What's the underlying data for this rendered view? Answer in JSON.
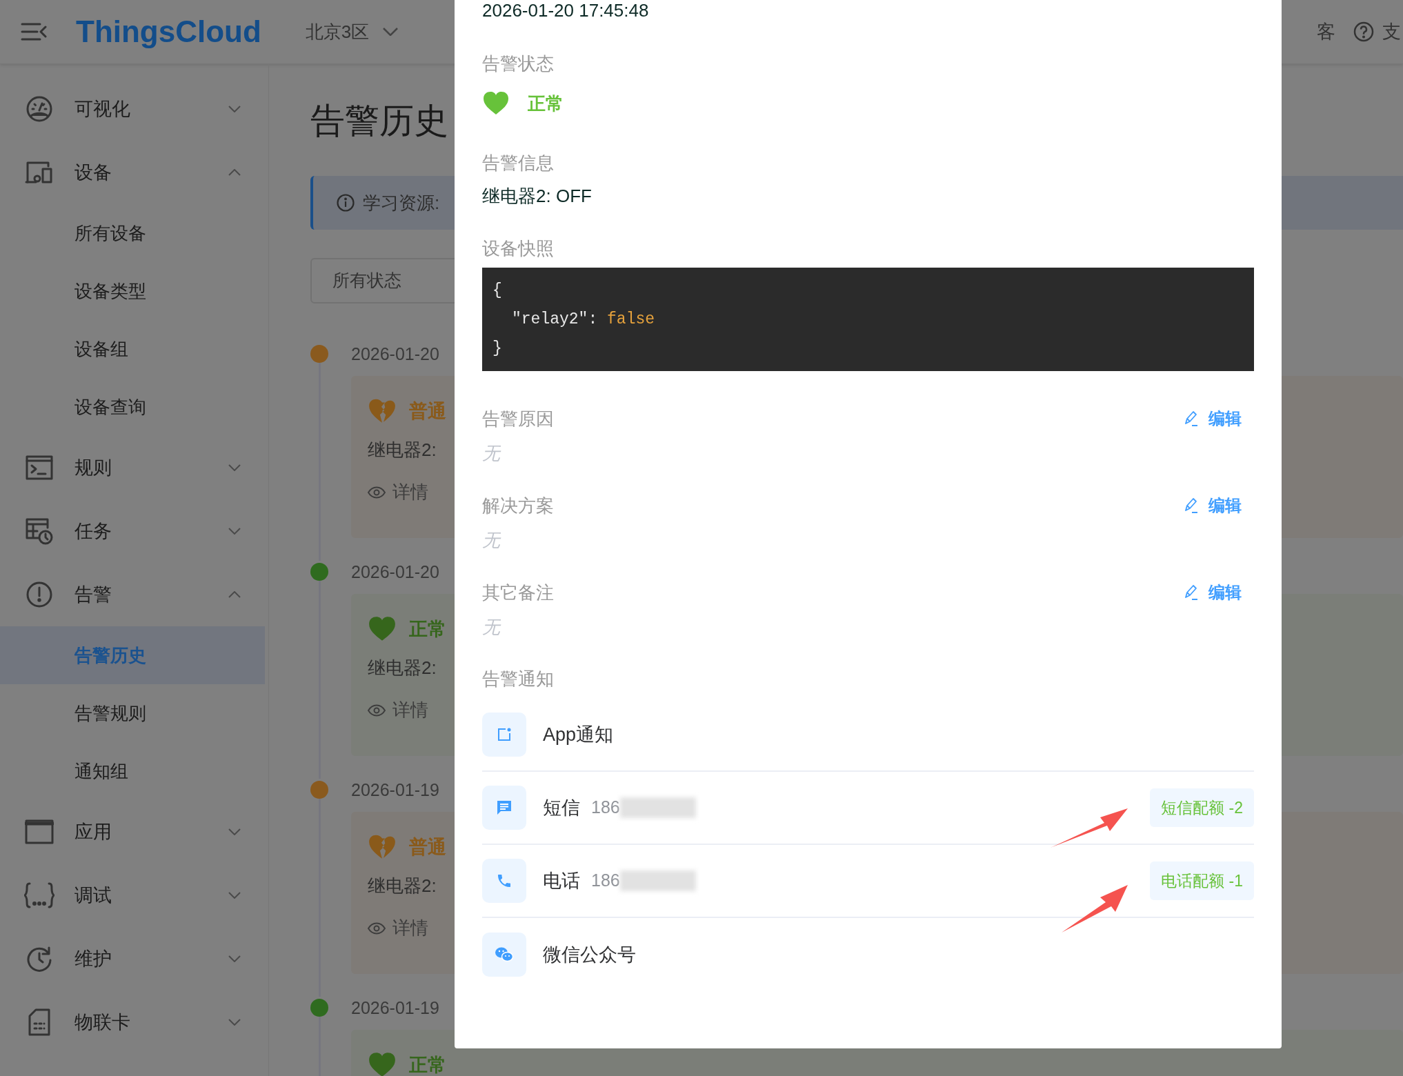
{
  "header": {
    "logo": "ThingsCloud",
    "region": "北京3区",
    "links": [
      {
        "kind": "plain",
        "label": "客"
      },
      {
        "kind": "help",
        "label": "支"
      }
    ]
  },
  "sidebar": {
    "items": [
      {
        "label": "可视化",
        "expanded": false
      },
      {
        "label": "设备",
        "expanded": true,
        "children": [
          {
            "label": "所有设备",
            "selected": false
          },
          {
            "label": "设备类型",
            "selected": false
          },
          {
            "label": "设备组",
            "selected": false
          },
          {
            "label": "设备查询",
            "selected": false
          }
        ]
      },
      {
        "label": "规则",
        "expanded": false
      },
      {
        "label": "任务",
        "expanded": false
      },
      {
        "label": "告警",
        "expanded": true,
        "children": [
          {
            "label": "告警历史",
            "selected": true
          },
          {
            "label": "告警规则",
            "selected": false
          },
          {
            "label": "通知组",
            "selected": false
          }
        ]
      },
      {
        "label": "应用",
        "expanded": false
      },
      {
        "label": "调试",
        "expanded": false
      },
      {
        "label": "维护",
        "expanded": false
      },
      {
        "label": "物联卡",
        "expanded": false
      }
    ]
  },
  "page": {
    "title": "告警历史",
    "info": "学习资源:",
    "filter": "所有状态",
    "timeline": [
      {
        "date": "2026-01-20",
        "kind": "warning",
        "status": "普通",
        "message": "继电器2:",
        "detail": "详情"
      },
      {
        "date": "2026-01-20",
        "kind": "normal",
        "status": "正常",
        "message": "继电器2:",
        "detail": "详情"
      },
      {
        "date": "2026-01-19",
        "kind": "warning",
        "status": "普通",
        "message": "继电器2:",
        "detail": "详情"
      },
      {
        "date": "2026-01-19",
        "kind": "normal",
        "status": "正常"
      }
    ]
  },
  "alarm_detail": {
    "time": "2026-01-20 17:45:48",
    "status": {
      "label": "告警状态",
      "kind": "normal",
      "text": "正常"
    },
    "message": {
      "label": "告警信息",
      "text": "继电器2: OFF"
    },
    "snapshot": {
      "label": "设备快照",
      "open": "{",
      "key": "\"relay2\":",
      "value": "false",
      "close": "}"
    },
    "notes": [
      {
        "label": "告警原因",
        "value": "无",
        "action": "编辑"
      },
      {
        "label": "解决方案",
        "value": "无",
        "action": "编辑"
      },
      {
        "label": "其它备注",
        "value": "无",
        "action": "编辑"
      }
    ],
    "notifications": {
      "label": "告警通知",
      "channels": [
        {
          "kind": "app",
          "name": "App通知"
        },
        {
          "kind": "sms",
          "name": "短信",
          "number": "186",
          "quota": "短信配额 -2"
        },
        {
          "kind": "phone",
          "name": "电话",
          "number": "186",
          "quota": "电话配额 -1"
        },
        {
          "kind": "wechat",
          "name": "微信公众号"
        }
      ]
    }
  }
}
